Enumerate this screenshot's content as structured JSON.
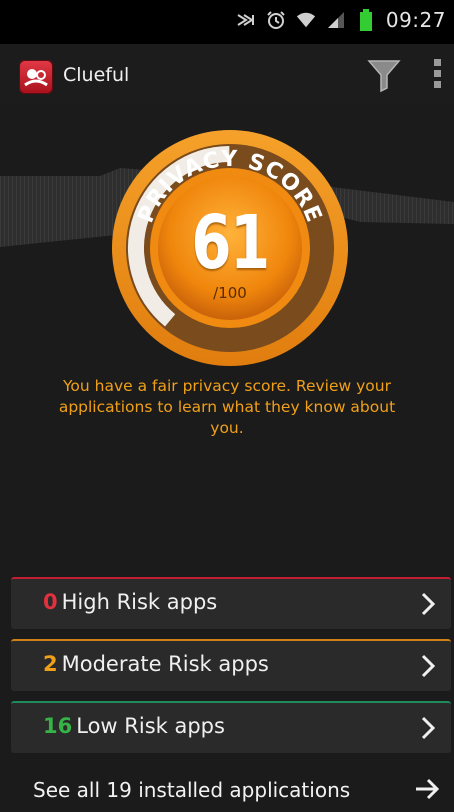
{
  "status_bar": {
    "time": "09:27",
    "icons": [
      "nfc-icon",
      "alarm-icon",
      "wifi-icon",
      "signal-icon",
      "battery-icon"
    ],
    "battery_color": "#33cc33"
  },
  "action_bar": {
    "app_name": "Clueful",
    "icons": [
      "app-logo-icon",
      "filter-icon",
      "overflow-menu-icon"
    ]
  },
  "score": {
    "banner": "PRIVACY SCORE",
    "value": "61",
    "max": "/100",
    "fraction": 0.61,
    "accent": "#f08a10"
  },
  "message": "You have a fair privacy score. Review your applications to learn what they know about you.",
  "risk_rows": [
    {
      "count": "0",
      "label": "High Risk apps",
      "color": "#e0313f",
      "icon": "chevron-right-icon"
    },
    {
      "count": "2",
      "label": "Moderate Risk apps",
      "color": "#efa019",
      "icon": "chevron-right-icon"
    },
    {
      "count": "16",
      "label": "Low Risk apps",
      "color": "#36b347",
      "icon": "chevron-right-icon"
    }
  ],
  "see_all": {
    "label": "See all 19 installed applications",
    "icon": "arrow-right-icon"
  }
}
